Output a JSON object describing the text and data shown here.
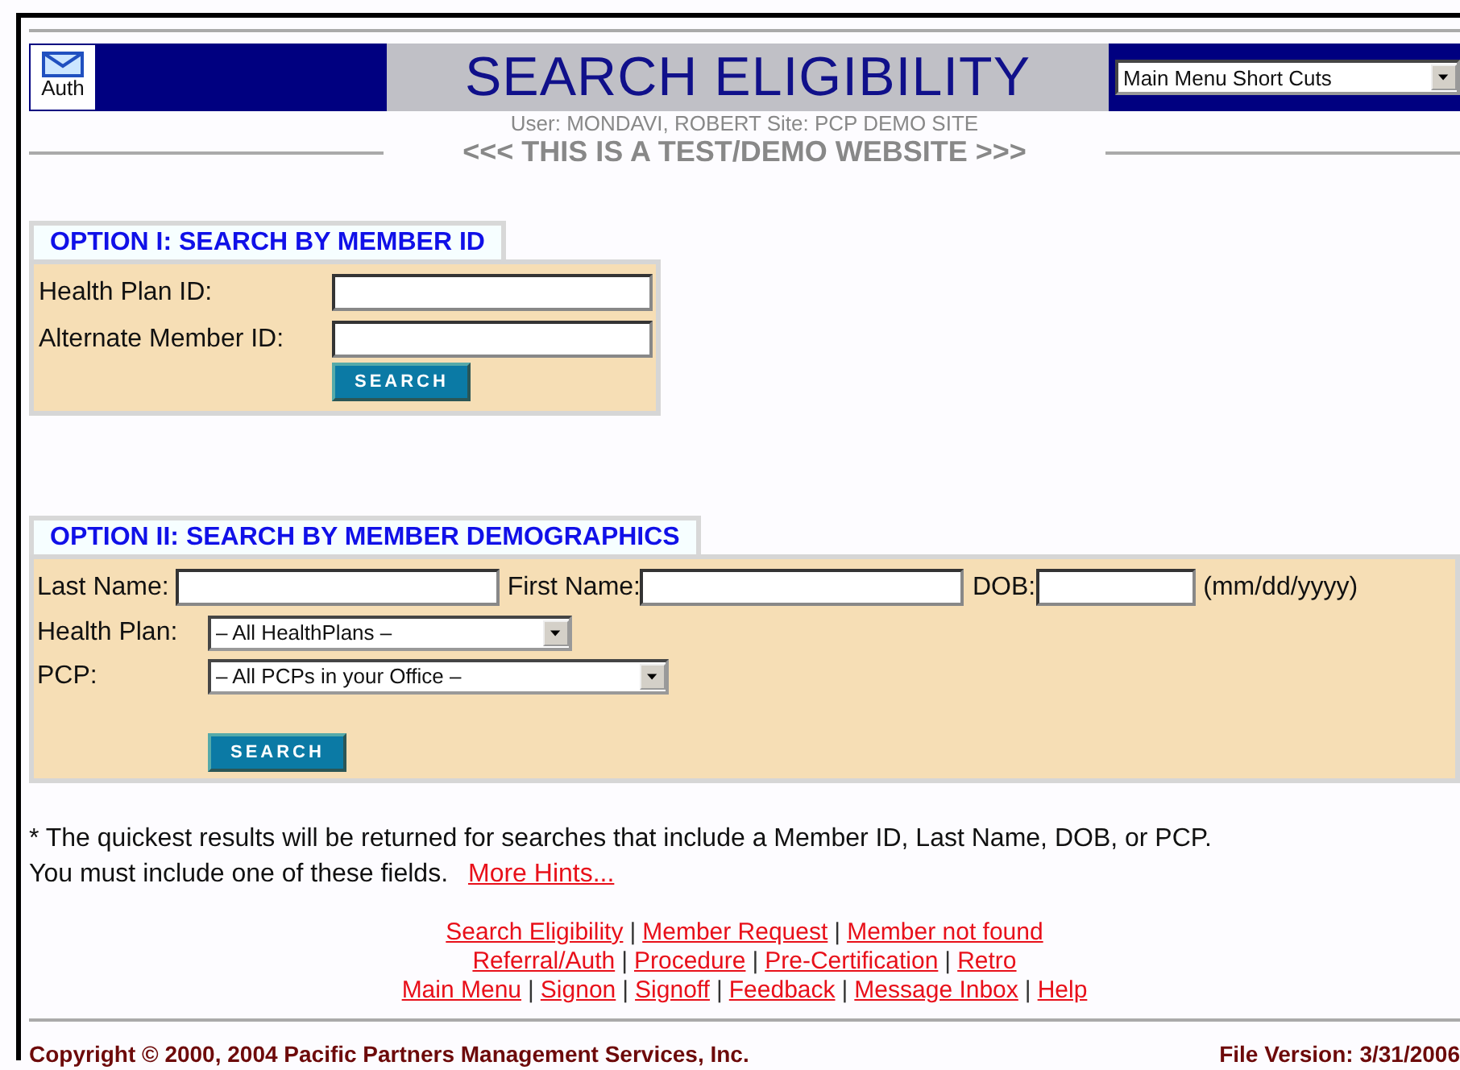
{
  "header": {
    "auth_label": "Auth",
    "title": "SEARCH ELIGIBILITY",
    "shortcut_select": "Main Menu Short Cuts",
    "user_line": "User: MONDAVI, ROBERT  Site: PCP DEMO SITE",
    "test_banner": "<<< THIS IS A TEST/DEMO WEBSITE >>>"
  },
  "option1": {
    "title": "OPTION I: SEARCH BY MEMBER ID",
    "fields": [
      {
        "label": "Health Plan ID:"
      },
      {
        "label": "Alternate Member ID:"
      }
    ],
    "button": "SEARCH"
  },
  "option2": {
    "title": "OPTION II: SEARCH BY MEMBER DEMOGRAPHICS",
    "name_fields": [
      {
        "label": "Last Name:"
      },
      {
        "label": "First Name:"
      },
      {
        "label": "DOB:"
      }
    ],
    "dob_hint": "(mm/dd/yyyy)",
    "selects": [
      {
        "label": "Health Plan:",
        "value": "– All HealthPlans –"
      },
      {
        "label": "PCP:",
        "value": "– All PCPs in your Office –"
      }
    ],
    "button": "SEARCH"
  },
  "note": {
    "line1": "*  The quickest results will be returned for searches that include a Member ID, Last Name, DOB, or PCP.",
    "line2": "You must include one of these fields.",
    "hint_link": "More Hints..."
  },
  "nav_links": {
    "separator": "|",
    "lines": [
      [
        "Search Eligibility",
        "Member Request",
        "Member not found"
      ],
      [
        "Referral/Auth",
        "Procedure",
        "Pre-Certification",
        "Retro"
      ],
      [
        "Main Menu",
        "Signon",
        "Signoff",
        "Feedback",
        "Message Inbox",
        "Help"
      ]
    ]
  },
  "footer": {
    "copyright": "Copyright © 2000, 2004 Pacific Partners Management Services, Inc.",
    "file_version": "File Version: 3/31/2006"
  }
}
